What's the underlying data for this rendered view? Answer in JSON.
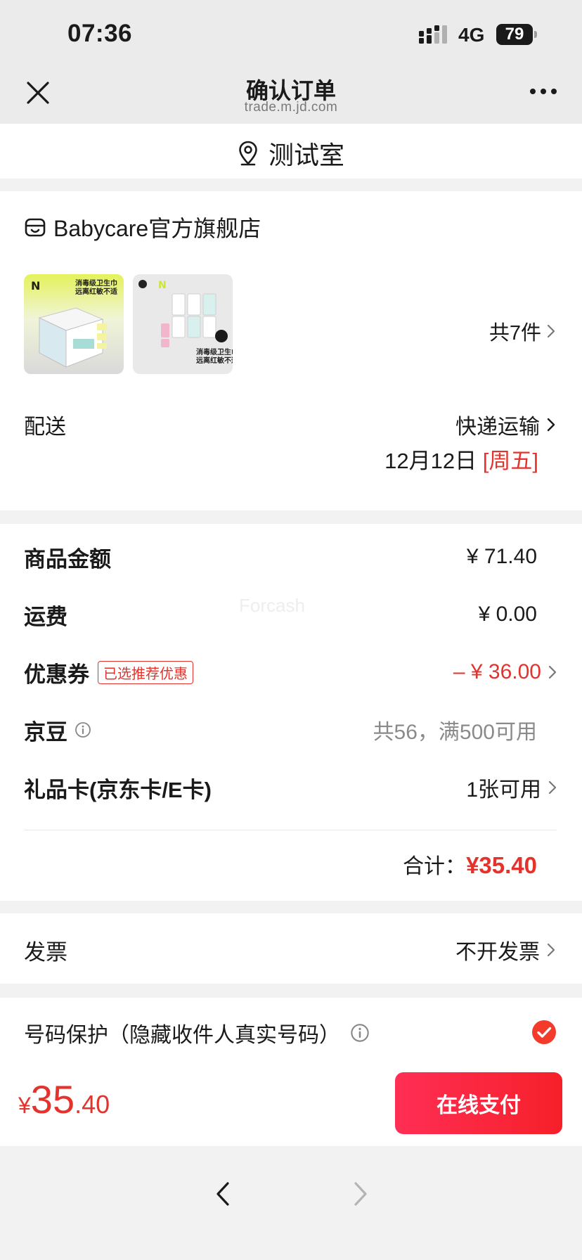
{
  "status_bar": {
    "time": "07:36",
    "network": "4G",
    "battery": "79"
  },
  "nav": {
    "title": "确认订单",
    "subtitle": "trade.m.jd.com"
  },
  "address": {
    "text": "测试室"
  },
  "shop": {
    "name": "Babycare官方旗舰店",
    "item_count_label": "共7件",
    "thumb1": {
      "brand": "N",
      "line1": "消毒级卫生巾",
      "line2": "远离红敏不适"
    },
    "thumb2": {
      "brand": "N",
      "line1": "消毒级卫生巾",
      "line2": "远离红敏不适"
    }
  },
  "shipping": {
    "label": "配送",
    "method": "快递运输",
    "date": "12月12日",
    "weekday": "[周五]"
  },
  "price_summary": {
    "goods_label": "商品金额",
    "goods_value": "¥ 71.40",
    "freight_label": "运费",
    "freight_value": "¥ 0.00",
    "coupon_label": "优惠券",
    "coupon_badge": "已选推荐优惠",
    "coupon_value": "– ¥ 36.00",
    "jingdou_label": "京豆",
    "jingdou_value": "共56，满500可用",
    "giftcard_label": "礼品卡(京东卡/E卡)",
    "giftcard_value": "1张可用",
    "total_label": "合计：",
    "total_value": "¥35.40"
  },
  "invoice": {
    "label": "发票",
    "value": "不开发票"
  },
  "protection": {
    "label": "号码保护（隐藏收件人真实号码）",
    "checked": true
  },
  "payment": {
    "currency": "¥",
    "integer": "35",
    "decimal": ".40",
    "button_label": "在线支付"
  },
  "watermark": "Forcash",
  "colors": {
    "accent_red": "#e4332c",
    "pay_gradient_start": "#ff2e54",
    "pay_gradient_end": "#f6202a"
  }
}
